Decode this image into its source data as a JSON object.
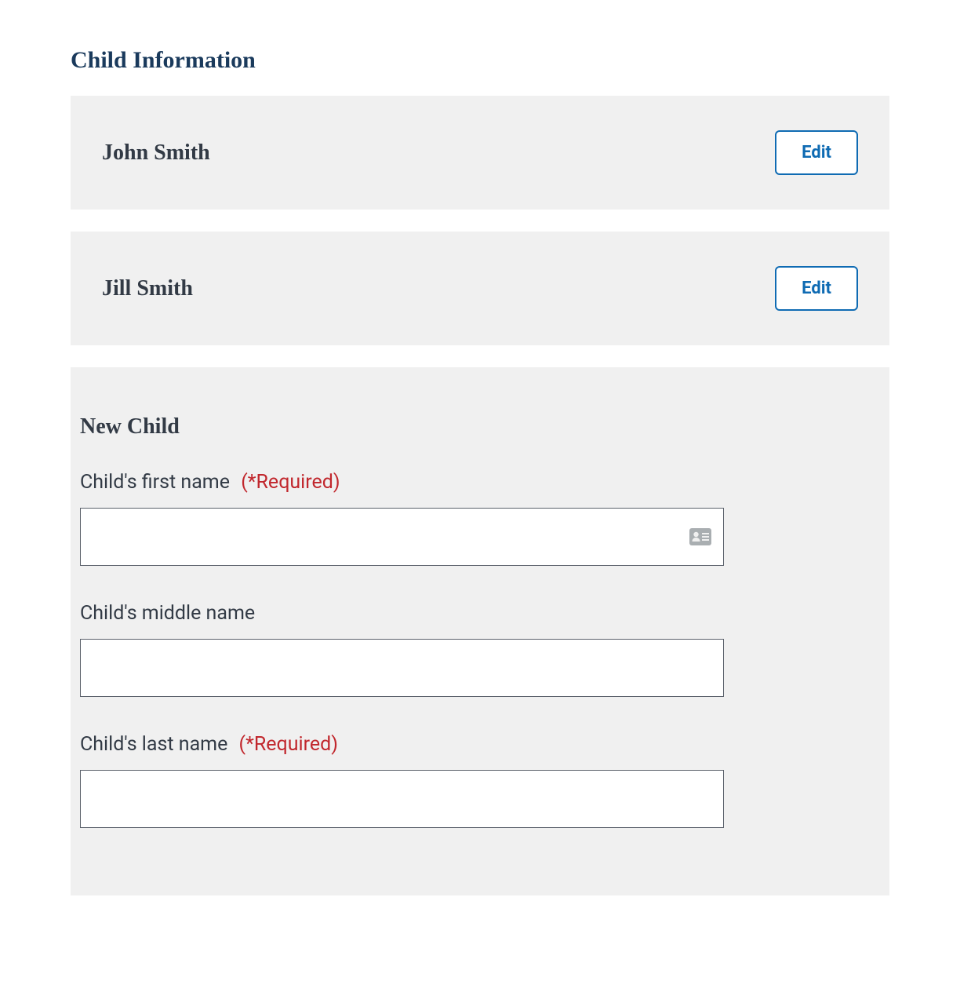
{
  "section_title": "Child Information",
  "children": [
    {
      "name": "John Smith",
      "edit_label": "Edit"
    },
    {
      "name": "Jill Smith",
      "edit_label": "Edit"
    }
  ],
  "form": {
    "title": "New Child",
    "required_tag": "(*Required)",
    "fields": {
      "first_name": {
        "label": "Child's first name",
        "required": true,
        "value": ""
      },
      "middle_name": {
        "label": "Child's middle name",
        "required": false,
        "value": ""
      },
      "last_name": {
        "label": "Child's last name",
        "required": true,
        "value": ""
      }
    }
  }
}
